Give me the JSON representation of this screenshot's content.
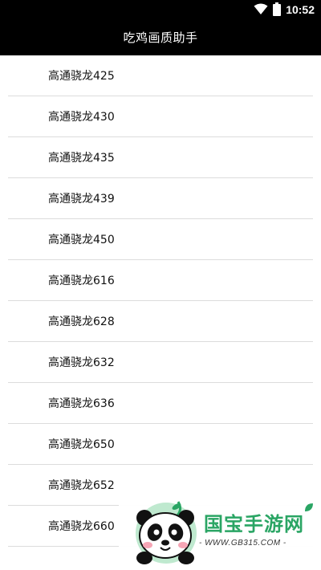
{
  "status_bar": {
    "time": "10:52"
  },
  "app_bar": {
    "title": "吃鸡画质助手"
  },
  "list": {
    "items": [
      "高通骁龙425",
      "高通骁龙430",
      "高通骁龙435",
      "高通骁龙439",
      "高通骁龙450",
      "高通骁龙616",
      "高通骁龙628",
      "高通骁龙632",
      "高通骁龙636",
      "高通骁龙650",
      "高通骁龙652",
      "高通骁龙660"
    ]
  },
  "watermark": {
    "brand": "国宝手游网",
    "url": "- WWW.GB315.COM -"
  },
  "icons": {
    "wifi": "wifi-icon",
    "battery": "battery-icon",
    "logo": "panda-logo-icon"
  }
}
